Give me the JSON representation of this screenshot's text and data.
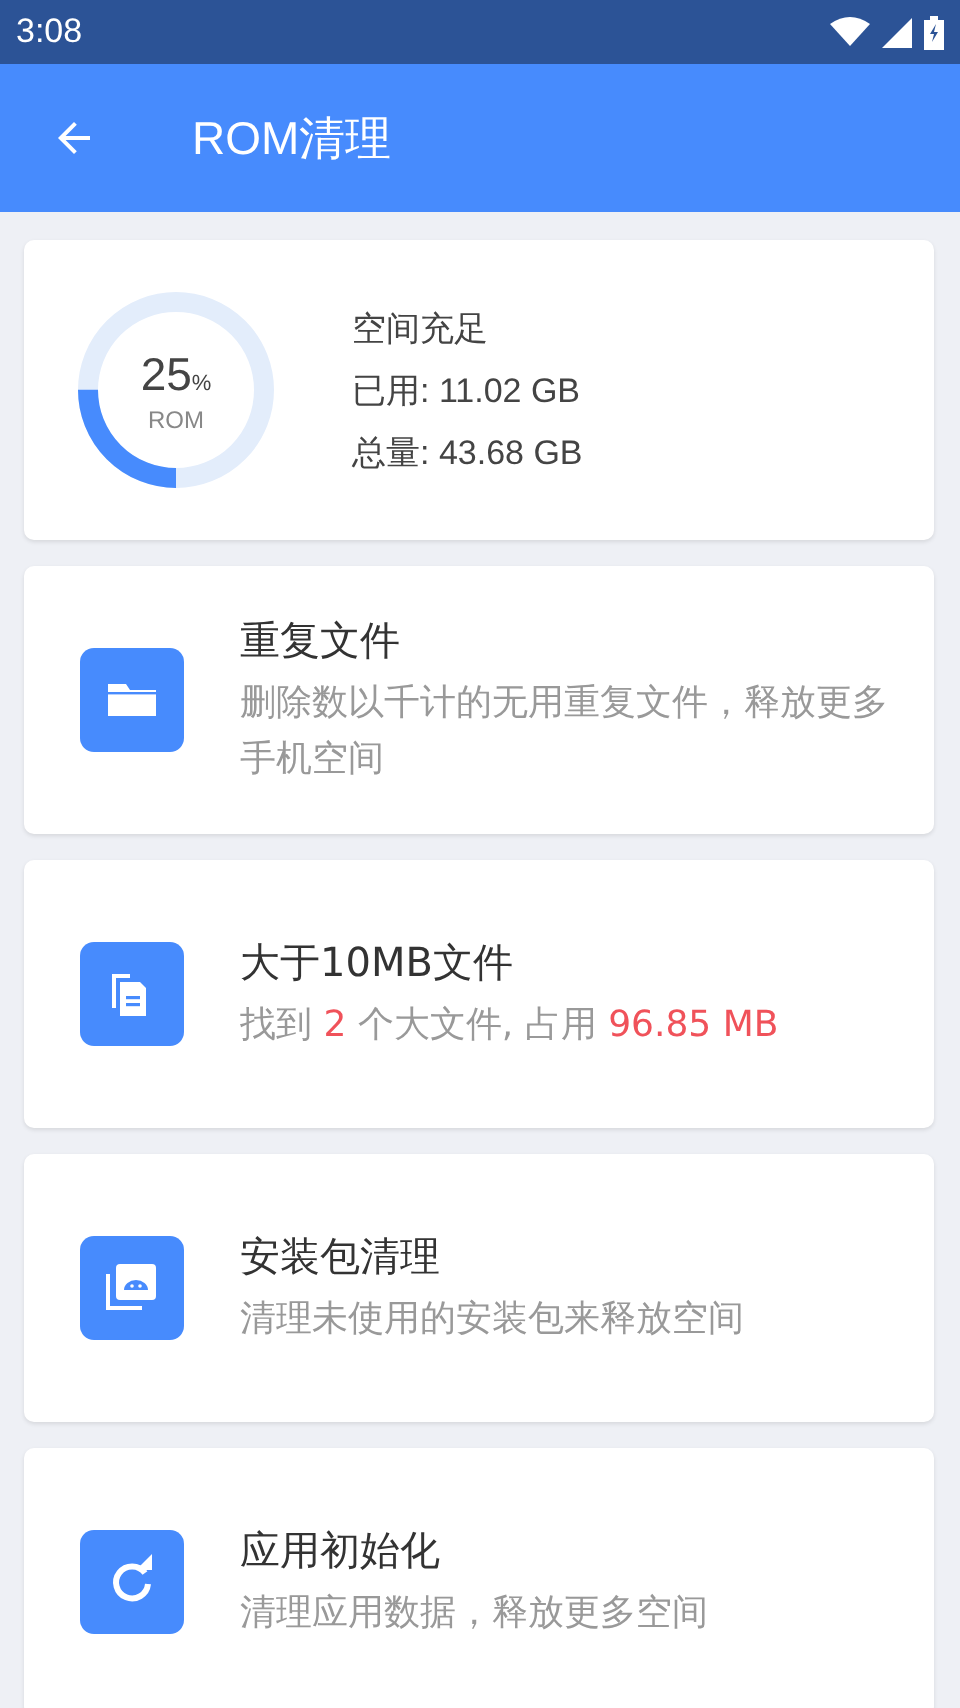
{
  "status_bar": {
    "time": "3:08"
  },
  "app_bar": {
    "title": "ROM清理"
  },
  "storage": {
    "level": 0.25,
    "percent": "25",
    "percent_sign": "%",
    "label": "ROM",
    "status": "空间充足",
    "used": "已用: 11.02 GB",
    "total": "总量: 43.68 GB"
  },
  "items": [
    {
      "kind": "folder",
      "title": "重复文件",
      "description": [
        {
          "text": "删除数以千计的无用重复文件，释放更多手机空间",
          "highlight": false
        }
      ]
    },
    {
      "kind": "documents",
      "title": "大于10MB文件",
      "description": [
        {
          "text": "找到 ",
          "highlight": false
        },
        {
          "text": "2",
          "highlight": true
        },
        {
          "text": " 个大文件, 占用 ",
          "highlight": false
        },
        {
          "text": "96.85 MB",
          "highlight": true
        }
      ]
    },
    {
      "kind": "package",
      "title": "安装包清理",
      "description": [
        {
          "text": "清理未使用的安装包来释放空间",
          "highlight": false
        }
      ]
    },
    {
      "kind": "refresh",
      "title": "应用初始化",
      "description": [
        {
          "text": "清理应用数据，释放更多空间",
          "highlight": false
        }
      ]
    }
  ]
}
